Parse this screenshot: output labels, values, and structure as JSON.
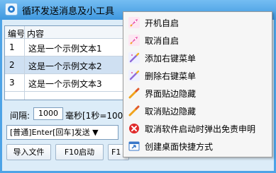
{
  "window": {
    "title": "循环发送消息及小工具"
  },
  "table": {
    "headers": [
      "编号",
      "内容"
    ],
    "rows": [
      {
        "num": "1",
        "text": "这是一个示例文本1"
      },
      {
        "num": "2",
        "text": "这是一个示例文本2"
      },
      {
        "num": "3",
        "text": "这是一个示例文本3"
      }
    ]
  },
  "controls": {
    "interval_label": "间隔:",
    "interval_value": "1000",
    "interval_unit": "毫秒[1秒=1000毫",
    "send_mode": "[普通]Enter[回车]发送 ▼"
  },
  "buttons": {
    "import": "导入文件",
    "f10": "F10启动",
    "f_partial": "F1"
  },
  "context_menu": {
    "items": [
      {
        "label": "开机自启",
        "icon": "rocket-icon"
      },
      {
        "label": "取消自启",
        "icon": "rocket-icon"
      },
      {
        "label": "添加右键菜单",
        "icon": "wand-icon"
      },
      {
        "label": "删除右键菜单",
        "icon": "wand-icon"
      },
      {
        "label": "界面贴边隐藏",
        "icon": "brush-icon"
      },
      {
        "label": "取消贴边隐藏",
        "icon": "brush-icon"
      },
      {
        "label": "取消软件启动时弹出免责申明",
        "icon": "close-circle-icon"
      },
      {
        "label": "创建桌面快捷方式",
        "icon": "shortcut-icon"
      }
    ]
  },
  "colors": {
    "titlebar": "#3f98df",
    "menu_bg": "#f6f6f6",
    "selected_row": "#cfe0f2",
    "rocket": "#e64aa6",
    "close": "#e02b2b"
  }
}
